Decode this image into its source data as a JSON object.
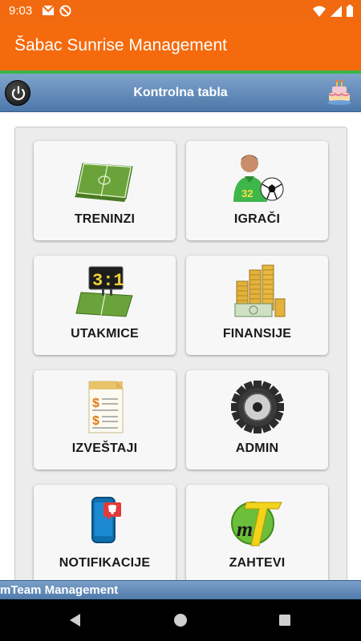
{
  "status_bar": {
    "time": "9:03",
    "icons_left": [
      "gmail-icon",
      "no-disturb-icon"
    ],
    "icons_right": [
      "wifi-icon",
      "signal-icon",
      "battery-icon"
    ]
  },
  "app_bar": {
    "title": "Šabac Sunrise Management"
  },
  "header": {
    "title": "Kontrolna tabla",
    "left_icon": "power-icon",
    "right_icon": "birthday-cake-icon"
  },
  "tiles": [
    {
      "label": "TRENINZI",
      "icon": "training-field-icon"
    },
    {
      "label": "IGRAČI",
      "icon": "player-icon"
    },
    {
      "label": "UTAKMICE",
      "icon": "scoreboard-icon"
    },
    {
      "label": "FINANSIJE",
      "icon": "coins-money-icon"
    },
    {
      "label": "IZVEŠTAJI",
      "icon": "report-document-icon"
    },
    {
      "label": "ADMIN",
      "icon": "gear-icon"
    },
    {
      "label": "NOTIFIKACIJE",
      "icon": "phone-notification-icon"
    },
    {
      "label": "ZAHTEVI",
      "icon": "mteam-logo-icon"
    }
  ],
  "footer": {
    "text": "mTeam Management"
  },
  "nav": [
    "back-icon",
    "home-icon",
    "recents-icon"
  ],
  "colors": {
    "app_bar": "#f56a0c",
    "accent_line": "#39b54a",
    "header_blue": "#5a83b3"
  }
}
